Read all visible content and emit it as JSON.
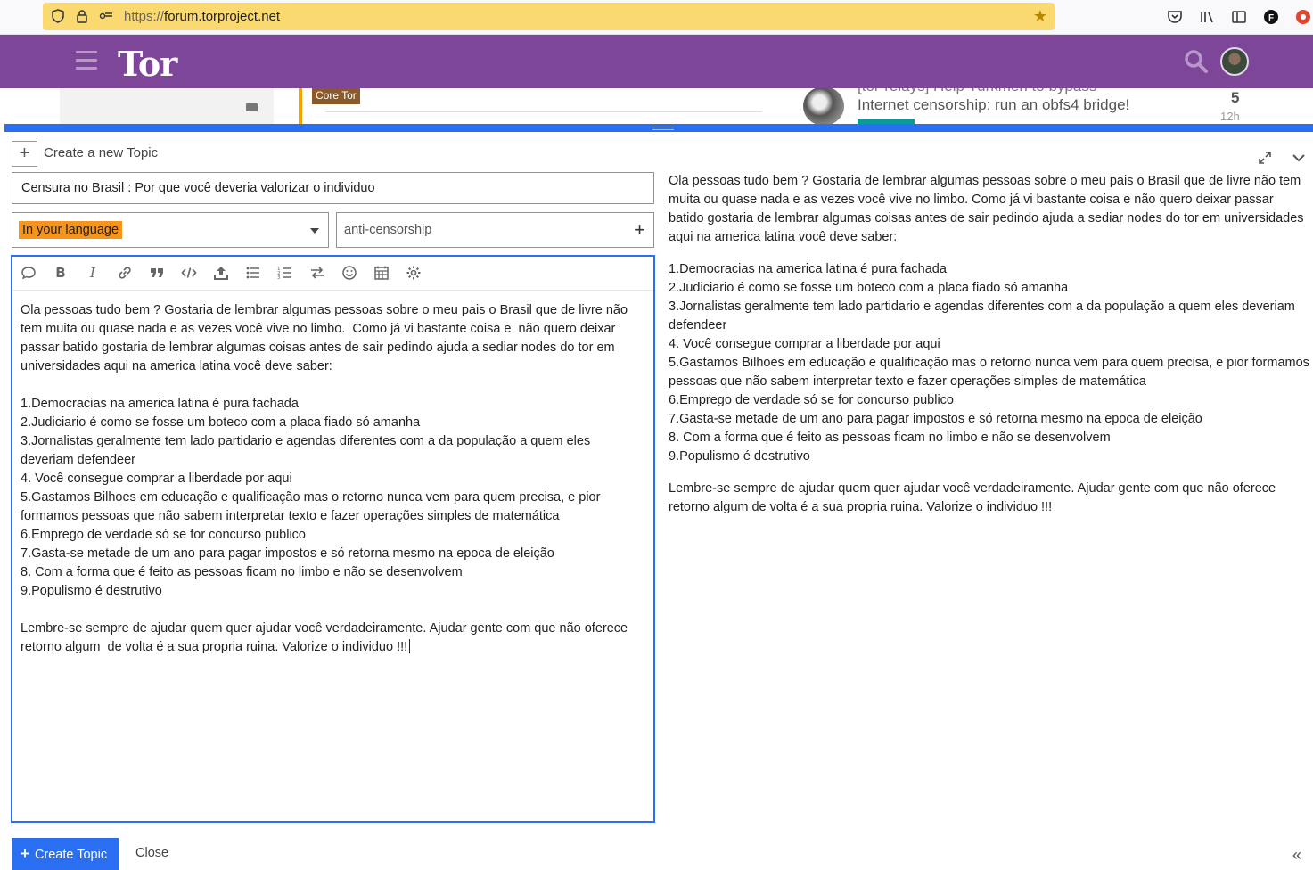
{
  "browser": {
    "url_proto": "https://",
    "url_host": "forum.torproject.net"
  },
  "header": {
    "logo_text": "Tor"
  },
  "background_page": {
    "category_badge": "Core Tor",
    "topic_fragment_top": "[tor-relays] Help Turkmen to bypass",
    "topic_fragment": "Internet censorship: run an obfs4 bridge!",
    "reply_count": "5",
    "time_ago": "12h"
  },
  "composer": {
    "action_title": "Create a new Topic",
    "title_value": "Censura no Brasil : Por que você deveria valorizar o individuo",
    "category_value": "In your language",
    "tag_value": "anti-censorship",
    "editor_body": "Ola pessoas tudo bem ? Gostaria de lembrar algumas pessoas sobre o meu pais o Brasil que de livre não tem muita ou quase nada e as vezes você vive no limbo.  Como já vi bastante coisa e  não quero deixar passar batido gostaria de lembrar algumas coisas antes de sair pedindo ajuda a sediar nodes do tor em universidades aqui na america latina você deve saber:\n\n1.Democracias na america latina é pura fachada\n2.Judiciario é como se fosse um boteco com a placa fiado só amanha\n3.Jornalistas geralmente tem lado partidario e agendas diferentes com a da população a quem eles deveriam defendeer\n4. Você consegue comprar a liberdade por aqui\n5.Gastamos Bilhoes em educação e qualificação mas o retorno nunca vem para quem precisa, e pior formamos pessoas que não sabem interpretar texto e fazer operações simples de matemática\n6.Emprego de verdade só se for concurso publico\n7.Gasta-se metade de um ano para pagar impostos e só retorna mesmo na epoca de eleição\n8. Com a forma que é feito as pessoas ficam no limbo e não se desenvolvem\n9.Populismo é destrutivo\n\nLembre-se sempre de ajudar quem quer ajudar você verdadeiramente. Ajudar gente com que não oferece retorno algum  de volta é a sua propria ruina. Valorize o individuo !!!",
    "preview": {
      "intro": "Ola pessoas tudo bem ? Gostaria de lembrar algumas pessoas sobre o meu pais o Brasil que de livre não tem muita ou quase nada e as vezes você vive no limbo. Como já vi bastante coisa e não quero deixar passar batido gostaria de lembrar algumas coisas antes de sair pedindo ajuda a sediar nodes do tor em universidades aqui na america latina você deve saber:",
      "list": "1.Democracias na america latina é pura fachada\n2.Judiciario é como se fosse um boteco com a placa fiado só amanha\n3.Jornalistas geralmente tem lado partidario e agendas diferentes com a da população a quem eles deveriam defendeer\n4. Você consegue comprar a liberdade por aqui\n5.Gastamos Bilhoes em educação e qualificação mas o retorno nunca vem para quem precisa, e pior formamos pessoas que não sabem interpretar texto e fazer operações simples de matemática\n6.Emprego de verdade só se for concurso publico\n7.Gasta-se metade de um ano para pagar impostos e só retorna mesmo na epoca de eleição\n8. Com a forma que é feito as pessoas ficam no limbo e não se desenvolvem\n9.Populismo é destrutivo",
      "outro": "Lembre-se sempre de ajudar quem quer ajudar você verdadeiramente. Ajudar gente com que não oferece retorno algum de volta é a sua propria ruina. Valorize o individuo !!!"
    },
    "submit_label": "Create Topic",
    "close_label": "Close"
  },
  "colors": {
    "header_purple": "#7d4698",
    "accent_blue": "#2a6ff2",
    "category_orange": "#f7941d",
    "url_bar_yellow": "#fbd971"
  },
  "icons": {
    "toolbar": [
      "quote-bubble-icon",
      "bold-icon",
      "italic-icon",
      "link-icon",
      "blockquote-icon",
      "code-icon",
      "upload-icon",
      "bullet-list-icon",
      "numbered-list-icon",
      "toggle-direction-icon",
      "emoji-icon",
      "calendar-icon",
      "gear-icon"
    ]
  }
}
